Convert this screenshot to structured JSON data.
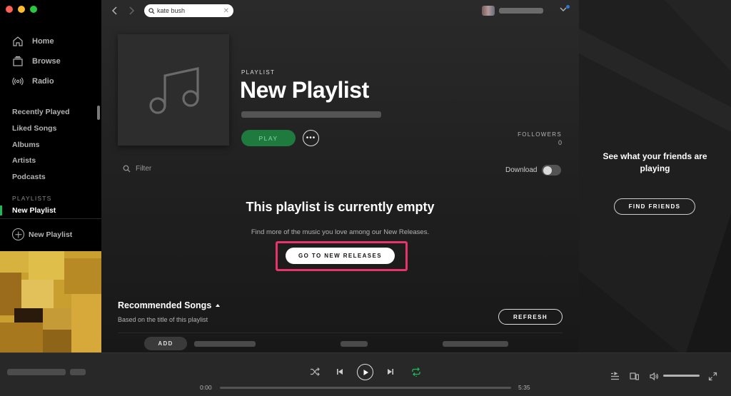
{
  "app": {
    "accent": "#1db954",
    "highlight": "#e8336d"
  },
  "sidebar": {
    "nav": [
      {
        "label": "Home",
        "icon": "home-icon"
      },
      {
        "label": "Browse",
        "icon": "browse-icon"
      },
      {
        "label": "Radio",
        "icon": "radio-icon"
      }
    ],
    "library": [
      "Recently Played",
      "Liked Songs",
      "Albums",
      "Artists",
      "Podcasts"
    ],
    "playlists_heading": "PLAYLISTS",
    "active_playlist": "New Playlist",
    "new_playlist_label": "New Playlist"
  },
  "topbar": {
    "search_value": "kate bush",
    "icons": [
      "back-arrow-icon",
      "forward-arrow-icon",
      "search-icon",
      "clear-icon",
      "chevron-down-icon"
    ]
  },
  "playlist": {
    "type_label": "PLAYLIST",
    "title": "New Playlist",
    "play_label": "PLAY",
    "more_label": "•••",
    "followers_label": "FOLLOWERS",
    "followers_count": "0",
    "filter_placeholder": "Filter",
    "download_label": "Download",
    "download_enabled": false
  },
  "empty_state": {
    "title": "This playlist is currently empty",
    "subtitle": "Find more of the music you love among our New Releases.",
    "button_label": "GO TO NEW RELEASES"
  },
  "recommended": {
    "title": "Recommended Songs",
    "subtitle": "Based on the title of this playlist",
    "refresh_label": "REFRESH",
    "add_label": "ADD"
  },
  "friends": {
    "message": "See what your friends are playing",
    "button_label": "FIND FRIENDS"
  },
  "player": {
    "elapsed": "0:00",
    "duration": "5:35",
    "progress_fraction": 0,
    "volume_fraction": 1,
    "shuffle_on": false,
    "repeat_on": true
  }
}
